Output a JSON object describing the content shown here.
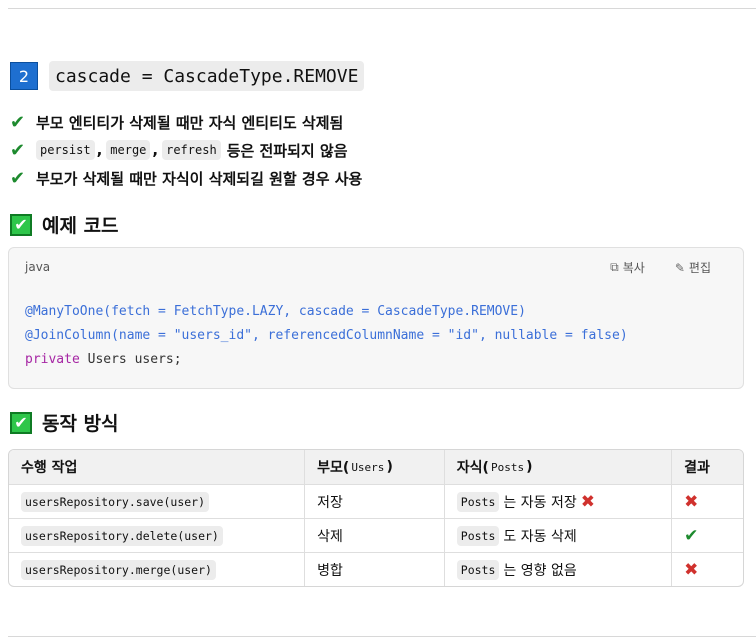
{
  "heading": {
    "number": "2",
    "code": "cascade = CascadeType.REMOVE"
  },
  "bullets": [
    {
      "text": "부모 엔티티가 삭제될 때만 자식 엔티티도 삭제됨"
    },
    {
      "chips": [
        "persist",
        "merge",
        "refresh"
      ],
      "separator": ",",
      "text": "등은 전파되지 않음"
    },
    {
      "text": "부모가 삭제될 때만 자식이 삭제되길 원할 경우 사용"
    }
  ],
  "example_section": {
    "title": "예제 코드"
  },
  "code_block": {
    "language": "java",
    "copy_label": "복사",
    "edit_label": "편집",
    "lines": [
      "@ManyToOne(fetch = FetchType.LAZY, cascade = CascadeType.REMOVE)",
      "@JoinColumn(name = \"users_id\", referencedColumnName = \"id\", nullable = false)"
    ],
    "line3_keyword": "private",
    "line3_rest": " Users users;"
  },
  "behavior_section": {
    "title": "동작 방식"
  },
  "table": {
    "headers": {
      "action": "수행 작업",
      "parent": "부모(",
      "parent_chip": "Users",
      "parent_close": ")",
      "child": "자식(",
      "child_chip": "Posts",
      "child_close": ")",
      "result": "결과"
    },
    "rows": [
      {
        "action": "usersRepository.save(user)",
        "parent": "저장",
        "child_chip": "Posts",
        "child_text": "는 자동 저장",
        "child_mark": "✖",
        "result": "✖",
        "result_type": "x"
      },
      {
        "action": "usersRepository.delete(user)",
        "parent": "삭제",
        "child_chip": "Posts",
        "child_text": "도 자동 삭제",
        "child_mark": "",
        "result": "✔",
        "result_type": "ok"
      },
      {
        "action": "usersRepository.merge(user)",
        "parent": "병합",
        "child_chip": "Posts",
        "child_text": "는 영향 없음",
        "child_mark": "",
        "result": "✖",
        "result_type": "x"
      }
    ]
  },
  "icons": {
    "check": "✔",
    "box_check": "✔",
    "copy_icon": "⧉",
    "edit_icon": "✎"
  }
}
